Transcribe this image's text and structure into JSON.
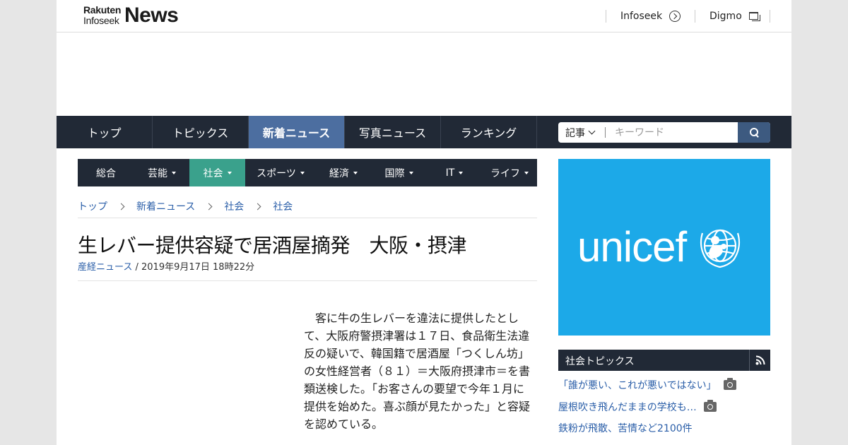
{
  "header": {
    "logo": {
      "line1": "Rakuten",
      "line2": "Infoseek",
      "brand": "News"
    },
    "links": [
      {
        "label": "Infoseek",
        "icon": "circle-arrow-icon"
      },
      {
        "label": "Digmo",
        "icon": "window-icon"
      }
    ]
  },
  "mainnav": {
    "tabs": [
      {
        "label": "トップ"
      },
      {
        "label": "トピックス"
      },
      {
        "label": "新着ニュース",
        "active": true
      },
      {
        "label": "写真ニュース"
      },
      {
        "label": "ランキング"
      }
    ],
    "search": {
      "scope": "記事",
      "placeholder": "キーワード",
      "icon": "search-icon"
    }
  },
  "catnav": {
    "items": [
      {
        "label": "総合",
        "dropdown": false
      },
      {
        "label": "芸能",
        "dropdown": true
      },
      {
        "label": "社会",
        "dropdown": true,
        "active": true
      },
      {
        "label": "スポーツ",
        "dropdown": true
      },
      {
        "label": "経済",
        "dropdown": true
      },
      {
        "label": "国際",
        "dropdown": true
      },
      {
        "label": "IT",
        "dropdown": true
      },
      {
        "label": "ライフ",
        "dropdown": true
      }
    ]
  },
  "breadcrumb": [
    "トップ",
    "新着ニュース",
    "社会",
    "社会"
  ],
  "article": {
    "title": "生レバー提供容疑で居酒屋摘発　大阪・摂津",
    "source": "産経ニュース",
    "datetime": " / 2019年9月17日 18時22分",
    "body": "　客に牛の生レバーを違法に提供したとして、大阪府警摂津署は１７日、食品衛生法違反の疑いで、韓国籍で居酒屋「つくしん坊」の女性経営者（８１）＝大阪府摂津市＝を書類送検した。「お客さんの要望で今年１月に提供を始めた。喜ぶ顔が見たかった」と容疑を認めている。"
  },
  "sidebar": {
    "ad": {
      "brand": "unicef",
      "background": "#1ca9e8"
    },
    "topics": {
      "title": "社会トピックス",
      "items": [
        {
          "text": "「誰が悪い、これが悪いではない」",
          "photo": true
        },
        {
          "text": "屋根吹き飛んだままの学校も…",
          "photo": true
        },
        {
          "text": "鉄粉が飛散、苦情など2100件",
          "photo": false
        }
      ]
    }
  },
  "colors": {
    "nav_bg": "#212936",
    "nav_active": "#4c6ea0",
    "cat_active": "#3aa18c",
    "link": "#2a5ea8"
  }
}
